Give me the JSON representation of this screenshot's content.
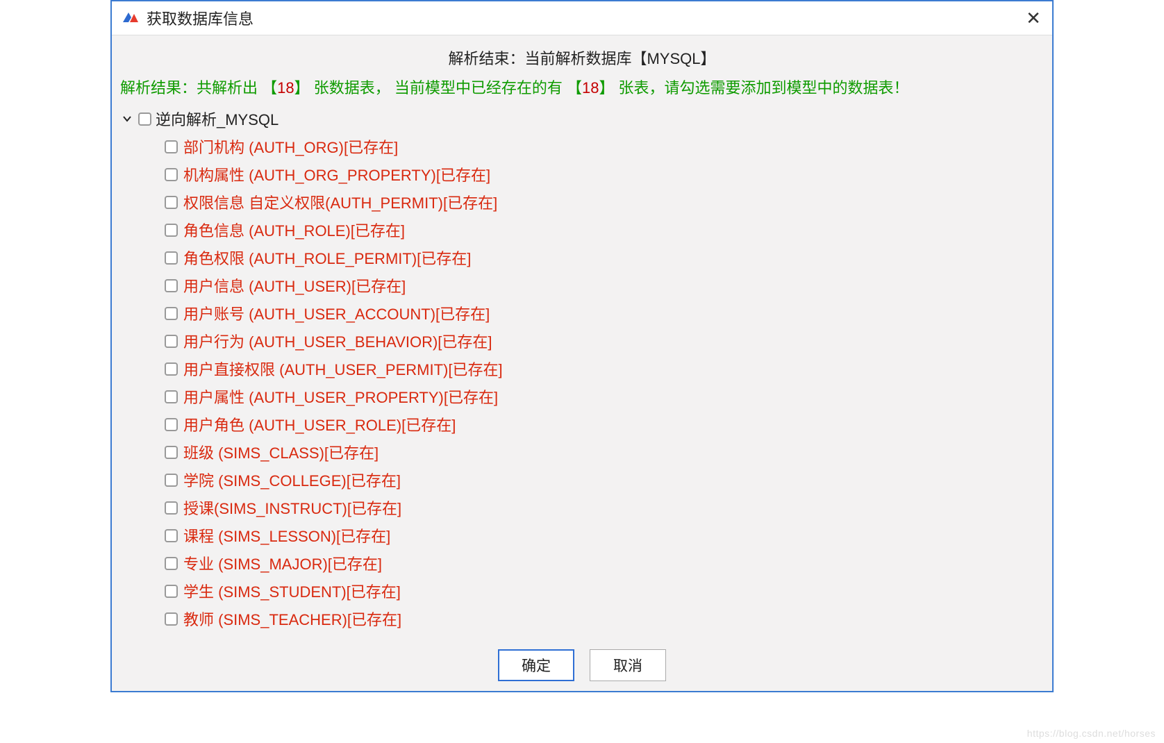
{
  "window": {
    "title": "获取数据库信息",
    "close_glyph": "✕"
  },
  "header": {
    "parse_end": "解析结束：当前解析数据库【MYSQL】",
    "parse_result_prefix": "解析结果：共解析出 【",
    "count_total": "18",
    "parse_result_mid1": "】 张数据表，   当前模型中已经存在的有 【",
    "count_existing": "18",
    "parse_result_suffix": "】 张表，请勾选需要添加到模型中的数据表！"
  },
  "tree": {
    "chevron_glyph": "⌄",
    "root_label": "逆向解析_MYSQL",
    "items": [
      {
        "label": "部门机构 (AUTH_ORG)[已存在]"
      },
      {
        "label": "机构属性 (AUTH_ORG_PROPERTY)[已存在]"
      },
      {
        "label": "权限信息 自定义权限(AUTH_PERMIT)[已存在]"
      },
      {
        "label": "角色信息 (AUTH_ROLE)[已存在]"
      },
      {
        "label": "角色权限 (AUTH_ROLE_PERMIT)[已存在]"
      },
      {
        "label": "用户信息 (AUTH_USER)[已存在]"
      },
      {
        "label": "用户账号 (AUTH_USER_ACCOUNT)[已存在]"
      },
      {
        "label": "用户行为 (AUTH_USER_BEHAVIOR)[已存在]"
      },
      {
        "label": "用户直接权限 (AUTH_USER_PERMIT)[已存在]"
      },
      {
        "label": "用户属性 (AUTH_USER_PROPERTY)[已存在]"
      },
      {
        "label": "用户角色 (AUTH_USER_ROLE)[已存在]"
      },
      {
        "label": "班级 (SIMS_CLASS)[已存在]"
      },
      {
        "label": "学院 (SIMS_COLLEGE)[已存在]"
      },
      {
        "label": "授课(SIMS_INSTRUCT)[已存在]"
      },
      {
        "label": "课程 (SIMS_LESSON)[已存在]"
      },
      {
        "label": "专业 (SIMS_MAJOR)[已存在]"
      },
      {
        "label": "学生 (SIMS_STUDENT)[已存在]"
      },
      {
        "label": "教师 (SIMS_TEACHER)[已存在]"
      }
    ]
  },
  "footer": {
    "ok_label": "确定",
    "cancel_label": "取消"
  },
  "watermark": "https://blog.csdn.net/horses"
}
